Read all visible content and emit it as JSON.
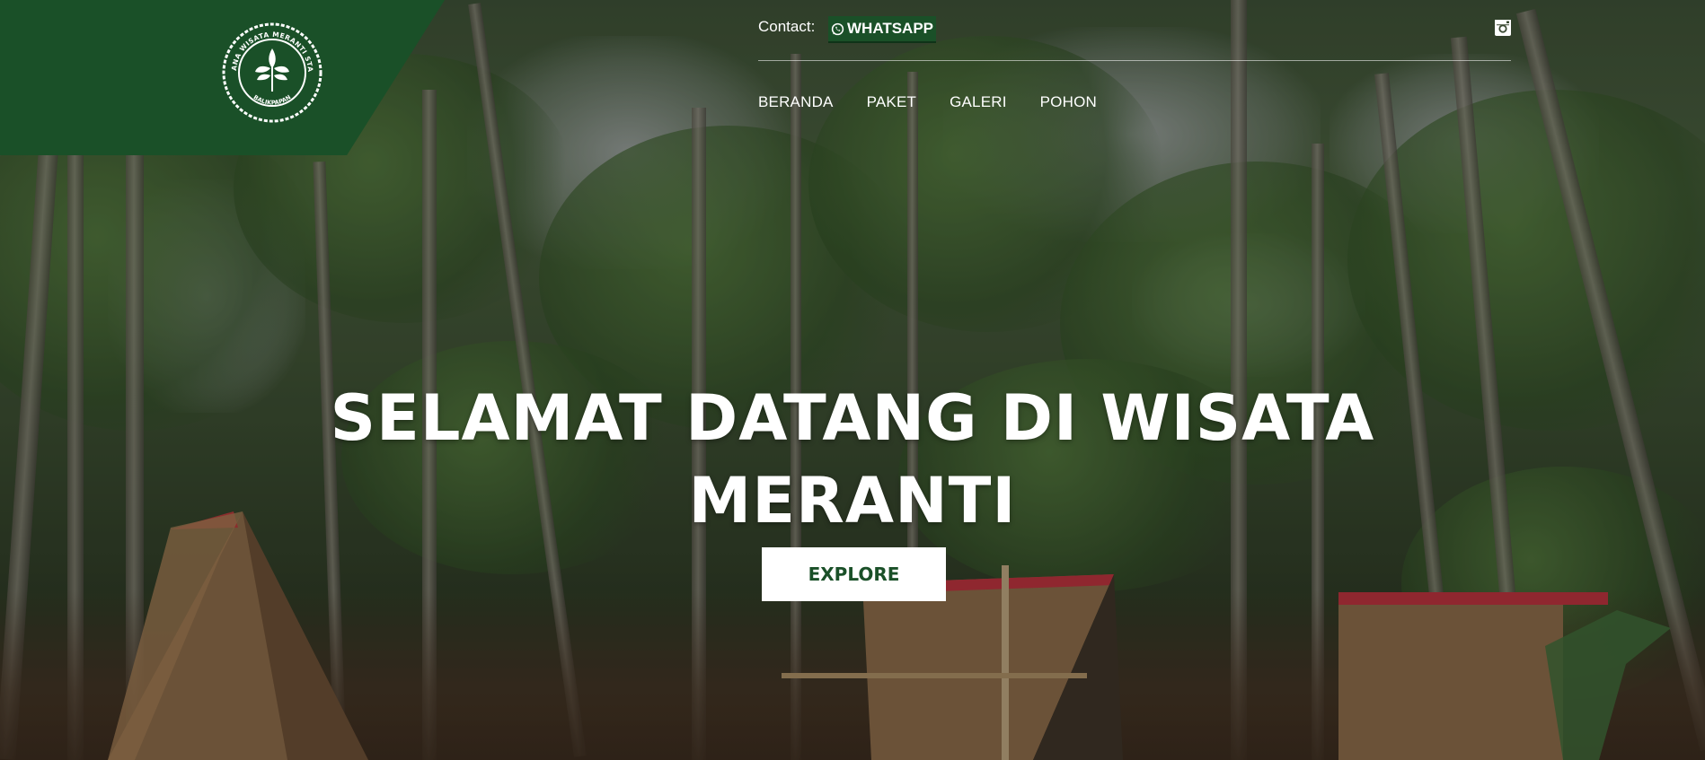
{
  "logo": {
    "alt": "Wana Wisata Meranti STAN Balikpapan",
    "ring_text": "WANA WISATA MERANTI STAN",
    "bottom_text": "BALIKPAPAN"
  },
  "topbar": {
    "contact_label": "Contact:",
    "whatsapp_label": "WHATSAPP",
    "whatsapp_icon": "whatsapp-icon",
    "instagram_icon": "instagram-icon"
  },
  "nav": {
    "items": [
      {
        "label": "BERANDA"
      },
      {
        "label": "PAKET"
      },
      {
        "label": "GALERI"
      },
      {
        "label": "POHON"
      }
    ]
  },
  "hero": {
    "title_line1": "SELAMAT DATANG DI WISATA",
    "title_line2": "MERANTI",
    "explore_label": "EXPLORE"
  },
  "colors": {
    "brand_green": "#1a5028",
    "text_white": "#ffffff"
  }
}
